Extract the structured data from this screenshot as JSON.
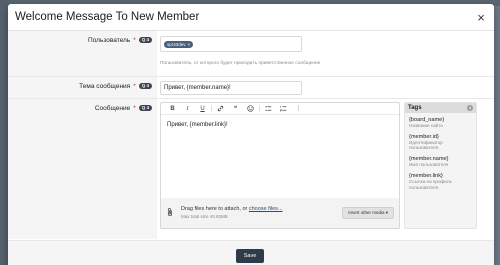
{
  "dialog": {
    "title": "Welcome Message To New Member",
    "close_glyph": "×"
  },
  "fields": {
    "user": {
      "label": "Пользователь",
      "required_mark": "*",
      "badge": "Q 4",
      "token": "spr43dev",
      "token_remove": "×",
      "hint": "Пользователь, от которого будет приходить приветственное сообщение"
    },
    "subject": {
      "label": "Тема сообщения",
      "required_mark": "*",
      "badge": "Q 4",
      "value": "Привет, {member.name}!"
    },
    "message": {
      "label": "Сообщение",
      "required_mark": "*",
      "badge": "Q 4",
      "value": "Привет, {member.link}!"
    }
  },
  "toolbar": {
    "bold": "B",
    "italic": "I",
    "underline": "U",
    "link_icon": "link-icon",
    "quote": "❝",
    "emoji_icon": "smiley-icon",
    "list_icon": "bullet-list-icon",
    "numbered_icon": "numbered-list-icon",
    "more": "⋮"
  },
  "attachments": {
    "clip_icon": "paperclip-icon",
    "drag_text": "Drag files here to attach, or",
    "choose_link": "choose files...",
    "max_size": "Max total size 40.83MB",
    "insert_button": "Insert other media ▾"
  },
  "tags_panel": {
    "title": "Tags",
    "help": "?",
    "items": [
      {
        "key": "{board_name}",
        "desc": "Название сайта"
      },
      {
        "key": "{member.id}",
        "desc": "Идентификатор пользователя"
      },
      {
        "key": "{member.name}",
        "desc": "Имя пользователя"
      },
      {
        "key": "{member.link}",
        "desc": "Ссылка на профиль пользователя"
      }
    ]
  },
  "footer": {
    "save_label": "Save"
  },
  "colors": {
    "primary_button": "#2f3b48",
    "token_bg": "#47607c",
    "link": "#2a4d7a"
  }
}
